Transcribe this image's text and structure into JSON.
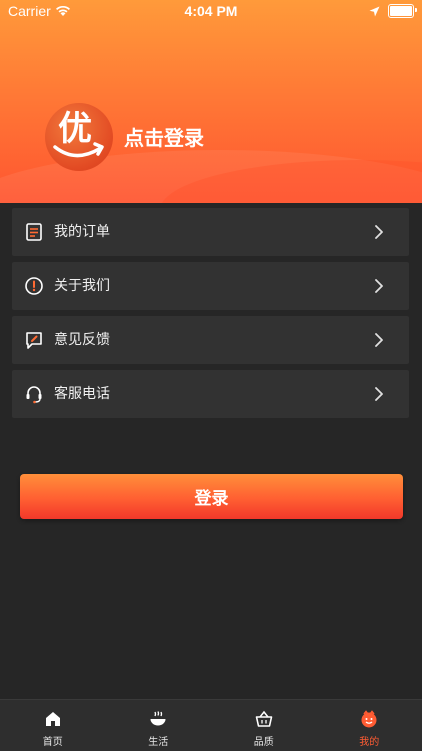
{
  "status_bar": {
    "carrier": "Carrier",
    "time": "4:04 PM",
    "battery_level": 1.0
  },
  "header": {
    "logo_text": "优",
    "login_prompt": "点击登录"
  },
  "menu": {
    "items": [
      {
        "label": "我的订单",
        "icon": "order-list-icon"
      },
      {
        "label": "关于我们",
        "icon": "info-icon"
      },
      {
        "label": "意见反馈",
        "icon": "feedback-icon"
      },
      {
        "label": "客服电话",
        "icon": "headset-icon"
      }
    ]
  },
  "login_button": {
    "label": "登录"
  },
  "tabbar": {
    "tabs": [
      {
        "label": "首页",
        "icon": "home-icon",
        "active": false
      },
      {
        "label": "生活",
        "icon": "bowl-icon",
        "active": false
      },
      {
        "label": "品质",
        "icon": "basket-icon",
        "active": false
      },
      {
        "label": "我的",
        "icon": "face-icon",
        "active": true
      }
    ]
  },
  "colors": {
    "accent": "#ff5c33",
    "background": "#262626",
    "card": "#323232"
  }
}
